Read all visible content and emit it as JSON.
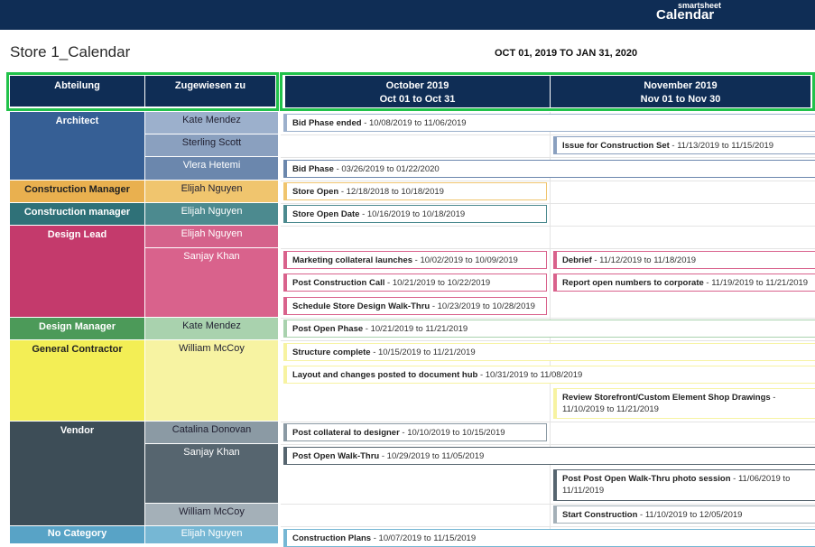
{
  "header": {
    "brand_small": "smartsheet",
    "brand_big": "Calendar"
  },
  "page": {
    "title": "Store 1_Calendar",
    "date_range": "OCT 01, 2019 TO JAN 31, 2020"
  },
  "columns": {
    "dept": "Abteilung",
    "assigned": "Zugewiesen zu",
    "months": [
      {
        "name": "October 2019",
        "range": "Oct 01 to Oct 31"
      },
      {
        "name": "November 2019",
        "range": "Nov 01 to Nov 30"
      }
    ]
  },
  "departments": [
    {
      "name": "Architect",
      "color": "#365f95"
    },
    {
      "name": "Construction Manager",
      "color": "#e9b04f"
    },
    {
      "name": "Construction manager",
      "color": "#2f7178"
    },
    {
      "name": "Design Lead",
      "color": "#c43a6c"
    },
    {
      "name": "Design Manager",
      "color": "#4c9a59"
    },
    {
      "name": "General Contractor",
      "color": "#f3ee55"
    },
    {
      "name": "Vendor",
      "color": "#3d4d57"
    },
    {
      "name": "No Category",
      "color": "#58a3c6"
    }
  ],
  "assignees": [
    "Kate Mendez",
    "Sterling Scott",
    "Vlera Hetemi",
    "Elijah Nguyen",
    "Elijah Nguyen",
    "Elijah Nguyen",
    "Sanjay Khan",
    "Kate Mendez",
    "William McCoy",
    "Catalina Donovan",
    "Sanjay Khan",
    "William McCoy",
    "Elijah Nguyen"
  ],
  "tasks": [
    {
      "name": "Bid Phase ended",
      "dates": " - 10/08/2019 to 11/06/2019"
    },
    {
      "name": "Issue for Construction Set",
      "dates": " - 11/13/2019 to 11/15/2019"
    },
    {
      "name": "Bid Phase",
      "dates": " - 03/26/2019 to 01/22/2020"
    },
    {
      "name": "Store Open",
      "dates": " - 12/18/2018 to 10/18/2019"
    },
    {
      "name": "Store Open Date",
      "dates": " - 10/16/2019 to 10/18/2019"
    },
    {
      "name": "Marketing collateral launches",
      "dates": " - 10/02/2019 to 10/09/2019"
    },
    {
      "name": "Debrief",
      "dates": " - 11/12/2019 to 11/18/2019"
    },
    {
      "name": "Post Construction Call",
      "dates": " - 10/21/2019 to 10/22/2019"
    },
    {
      "name": "Report open numbers to corporate",
      "dates": " - 11/19/2019 to 11/21/2019"
    },
    {
      "name": "Schedule Store Design Walk-Thru",
      "dates": " - 10/23/2019 to 10/28/2019"
    },
    {
      "name": "Post Open Phase",
      "dates": " - 10/21/2019 to 11/21/2019"
    },
    {
      "name": "Structure complete",
      "dates": " - 10/15/2019 to 11/21/2019"
    },
    {
      "name": "Layout and changes posted to document hub",
      "dates": " - 10/31/2019 to 11/08/2019"
    },
    {
      "name": "Review Storefront/Custom Element Shop Drawings",
      "dates": " - 11/10/2019 to 11/21/2019"
    },
    {
      "name": "Post collateral to designer",
      "dates": " - 10/10/2019 to 10/15/2019"
    },
    {
      "name": "Post Open Walk-Thru",
      "dates": " - 10/29/2019 to 11/05/2019"
    },
    {
      "name": "Post Post Open Walk-Thru photo session",
      "dates": " - 11/06/2019 to 11/11/2019"
    },
    {
      "name": "Start Construction",
      "dates": " - 11/10/2019 to 12/05/2019"
    },
    {
      "name": "Construction Plans",
      "dates": " - 10/07/2019 to 11/15/2019"
    }
  ]
}
